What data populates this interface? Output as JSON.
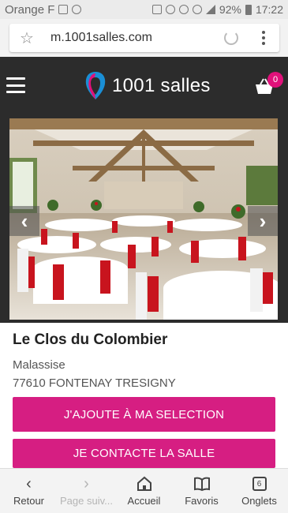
{
  "status_bar": {
    "carrier": "Orange F",
    "battery": "92%",
    "time": "17:22"
  },
  "browser": {
    "url": "m.1001salles.com"
  },
  "header": {
    "logo_text": "1001 salles",
    "cart_count": "0"
  },
  "venue": {
    "name": "Le Clos du Colombier",
    "address_line1": "Malassise",
    "address_line2": "77610 FONTENAY TRESIGNY"
  },
  "actions": {
    "add_selection": "J'AJOUTE À MA SELECTION",
    "contact": "JE CONTACTE LA SALLE"
  },
  "bottom_nav": {
    "back": "Retour",
    "forward": "Page suiv...",
    "home": "Accueil",
    "favorites": "Favoris",
    "tabs": "Onglets",
    "tabs_count": "6"
  },
  "colors": {
    "accent": "#d61e82",
    "header_bg": "#2c2c2c"
  }
}
